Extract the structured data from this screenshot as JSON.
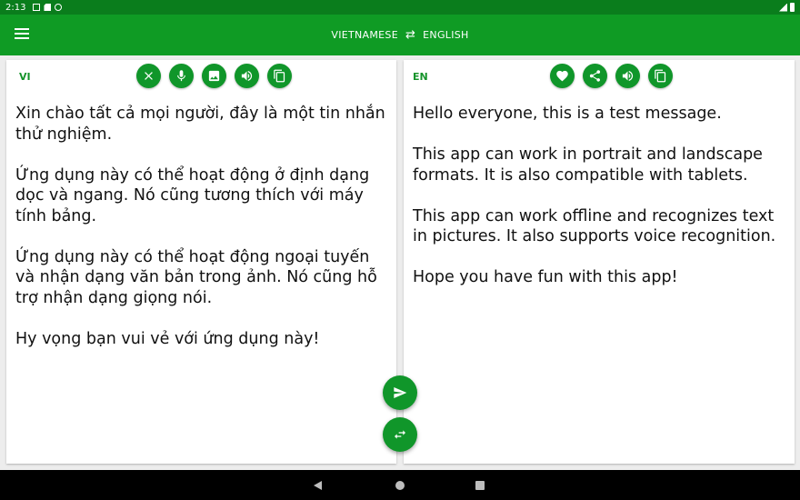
{
  "status_bar": {
    "time": "2:13",
    "icons": [
      "a-icon",
      "sd-card-icon",
      "sync-icon"
    ]
  },
  "app_bar": {
    "source_language": "VIETNAMESE",
    "target_language": "ENGLISH",
    "swap_glyph": "⇄",
    "icons": [
      "menu-icon",
      "swap-icon"
    ]
  },
  "source_panel": {
    "code": "VI",
    "actions": [
      "clear-icon",
      "mic-icon",
      "image-icon",
      "speaker-icon",
      "copy-icon"
    ],
    "text": "Xin chào tất cả mọi người, đây là một tin nhắn thử nghiệm.\n\nỨng dụng này có thể hoạt động ở định dạng dọc và ngang. Nó cũng tương thích với máy tính bảng.\n\nỨng dụng này có thể hoạt động ngoại tuyến và nhận dạng văn bản trong ảnh. Nó cũng hỗ trợ nhận dạng giọng nói.\n\nHy vọng bạn vui vẻ với ứng dụng này!"
  },
  "target_panel": {
    "code": "EN",
    "actions": [
      "heart-icon",
      "share-icon",
      "speaker-icon",
      "copy-icon"
    ],
    "text": "Hello everyone, this is a test message.\n\nThis app can work in portrait and landscape formats. It is also compatible with tablets.\n\nThis app can work offline and recognizes text in pictures. It also supports voice recognition.\n\nHope you have fun with this app!"
  },
  "fabs": [
    "send-icon",
    "swap-icon"
  ],
  "colors": {
    "status_bar": "#0a7d1c",
    "app_bar": "#0f9b24",
    "accent": "#10962a",
    "background": "#ededed"
  }
}
